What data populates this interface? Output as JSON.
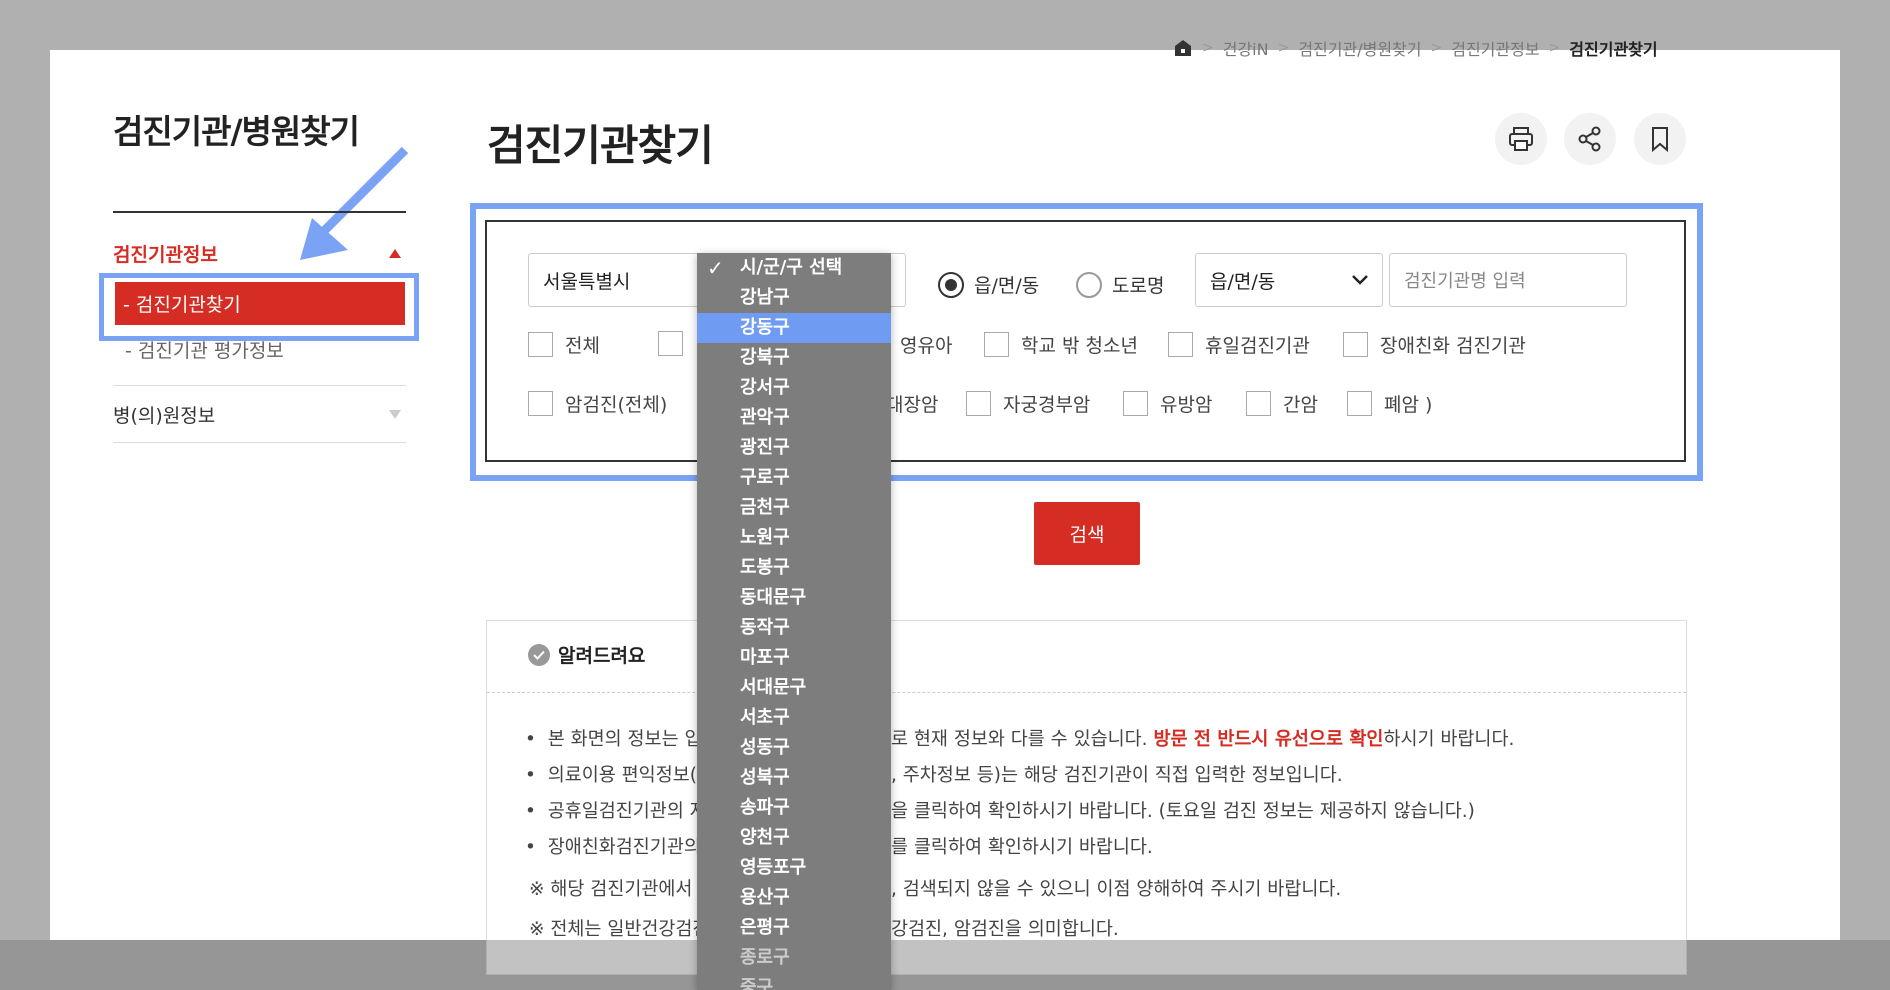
{
  "breadcrumb": {
    "items": [
      "건강iN",
      "검진기관/병원찾기",
      "검진기관정보"
    ],
    "current": "검진기관찾기"
  },
  "sidebar": {
    "title": "검진기관/병원찾기",
    "section1": "검진기관정보",
    "active_item": "-  검진기관찾기",
    "sub_item2": "-  검진기관 평가정보",
    "section2": "병(의)원정보"
  },
  "page_title": "검진기관찾기",
  "form": {
    "sido_select": "서울특별시",
    "radio_1": "읍/면/동",
    "radio_2": "도로명",
    "emd_select": "읍/면/동",
    "name_input_placeholder": "검진기관명 입력",
    "row1": [
      "전체",
      "영유아",
      "학교 밖 청소년",
      "휴일검진기관",
      "장애친화 검진기관"
    ],
    "row2": [
      "암검진(전체)",
      "대장암",
      "자궁경부암",
      "유방암",
      "간암",
      "폐암 )"
    ]
  },
  "search_button": "검색",
  "notice": {
    "title": "알려드려요",
    "lines": [
      {
        "a": "본 화면의 정보는 입력",
        "b": "로 현재 정보와 다를 수 있습니다.",
        "red": "방문 전 반드시 유선으로 확인",
        "c": "하시기 바랍니다."
      },
      {
        "a": "의료이용 편익정보(주",
        "b": ", 주차정보 등)는 해당 검진기관이 직접 입력한 정보입니다."
      },
      {
        "a": "공휴일검진기관의 자",
        "b": "을 클릭하여 확인하시기 바랍니다. (토요일 검진 정보는 제공하지 않습니다.)"
      },
      {
        "a": "장애친화검진기관의",
        "b": "를 클릭하여 확인하시기 바랍니다."
      },
      {
        "a": "※ 해당 검진기관에서 입",
        "b": ", 검색되지 않을 수 있으니 이점 양해하여 주시기 바랍니다."
      },
      {
        "a": "※ 전체는 일반건강검진",
        "b": "강검진, 암검진을 의미합니다."
      }
    ]
  },
  "dropdown": {
    "options": [
      "시/군/구 선택",
      "강남구",
      "강동구",
      "강북구",
      "강서구",
      "관악구",
      "광진구",
      "구로구",
      "금천구",
      "노원구",
      "도봉구",
      "동대문구",
      "동작구",
      "마포구",
      "서대문구",
      "서초구",
      "성동구",
      "성북구",
      "송파구",
      "양천구",
      "영등포구",
      "용산구",
      "은평구",
      "종로구",
      "중구"
    ],
    "highlighted": "강동구",
    "checked": "시/군/구 선택"
  },
  "colors": {
    "accent_red": "#d52d23",
    "highlight_blue": "#7aa3f5",
    "dropdown_bg": "#7d7d7d",
    "dropdown_selected": "#6f9bf3"
  }
}
